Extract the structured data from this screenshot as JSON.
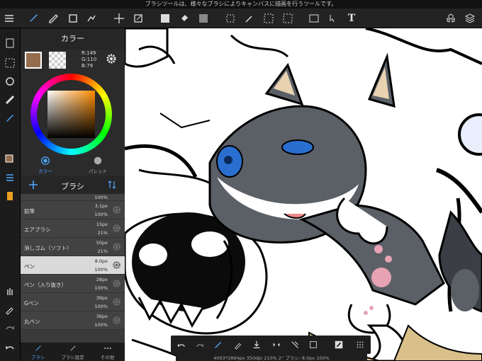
{
  "status_text": "ブラシツールは、様々なブラシによりキャンバスに描画を行うツールです。",
  "color_panel": {
    "title": "カラー",
    "r": "R:149",
    "g": "G:110",
    "b": "B:79",
    "tab_color": "カラー",
    "tab_palette": "パレット",
    "current_color": "#956e4f"
  },
  "brush_panel": {
    "title": "ブラシ",
    "items": [
      {
        "name": "",
        "size": "",
        "pct": "100%"
      },
      {
        "name": "鉛筆",
        "size": "3.1px",
        "pct": "100%"
      },
      {
        "name": "エアブラシ",
        "size": "15px",
        "pct": "21%"
      },
      {
        "name": "消しゴム（ソフト）",
        "size": "50px",
        "pct": "21%"
      },
      {
        "name": "ペン",
        "size": "8.0px",
        "pct": "100%"
      },
      {
        "name": "ペン（入り抜き）",
        "size": "28px",
        "pct": "100%"
      },
      {
        "name": "Gペン",
        "size": "39px",
        "pct": "100%"
      },
      {
        "name": "丸ペン",
        "size": "36px",
        "pct": "100%"
      }
    ]
  },
  "bottom_info": "4093*2894px 350dpi 210% 2° ブラシ: 8.0px 100%",
  "tabs": {
    "brush": "ブラシ",
    "brush_settings": "ブラシ設定",
    "other": "その他"
  }
}
